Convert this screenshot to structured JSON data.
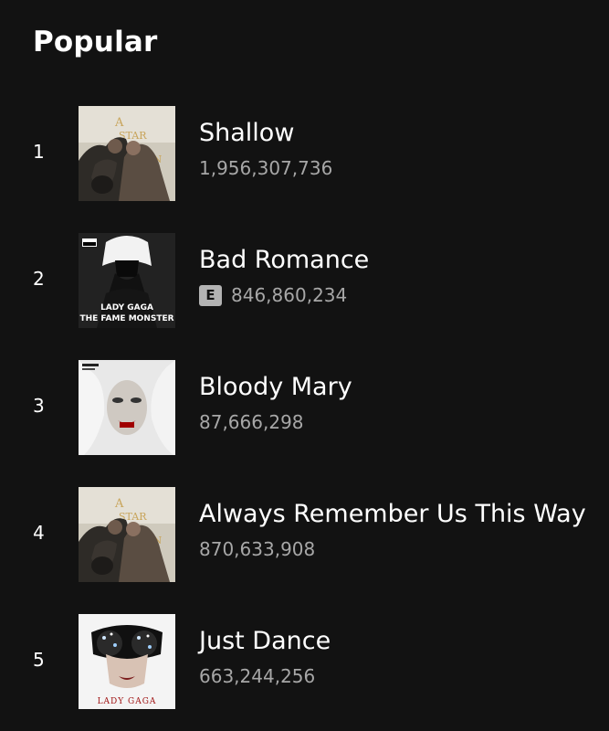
{
  "section_title": "Popular",
  "tracks": [
    {
      "rank": "1",
      "title": "Shallow",
      "plays": "1,956,307,736",
      "explicit": false,
      "cover": "a-star-is-born-cover"
    },
    {
      "rank": "2",
      "title": "Bad Romance",
      "plays": "846,860,234",
      "explicit": true,
      "explicit_label": "E",
      "cover": "the-fame-monster-cover",
      "cover_text_1": "LADY GAGA",
      "cover_text_2": "THE FAME MONSTER"
    },
    {
      "rank": "3",
      "title": "Bloody Mary",
      "plays": "87,666,298",
      "explicit": false,
      "cover": "born-this-way-cover"
    },
    {
      "rank": "4",
      "title": "Always Remember Us This Way",
      "plays": "870,633,908",
      "explicit": false,
      "cover": "a-star-is-born-cover"
    },
    {
      "rank": "5",
      "title": "Just Dance",
      "plays": "663,244,256",
      "explicit": false,
      "cover": "the-fame-cover",
      "cover_text_1": "LADY GAGA"
    }
  ],
  "colors": {
    "background": "#121212",
    "primary_text": "#ffffff",
    "secondary_text": "#a7a7a7",
    "badge": "#b3b3b3"
  }
}
